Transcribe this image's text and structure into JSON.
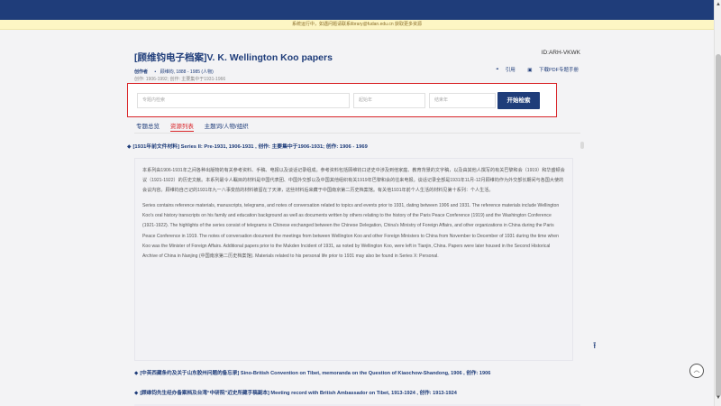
{
  "banner": "系统运行中，如遇问题请联系library@fudan.edu.cn  获取更多资源",
  "header": {
    "title": "[顾维钧电子档案]V. K. Wellington Koo papers",
    "id": "ID:ARH-VKWK",
    "meta_label": "创作者",
    "meta_value": "顾维钧, 1888 - 1985 (人物)",
    "meta_dates": "创作: 1906-1992; 创作: 主要集中于1931-1966",
    "cite": "引用",
    "pdf": "下载PDF专题手册"
  },
  "search": {
    "query_placeholder": "专题内检索",
    "start_placeholder": "起始年",
    "end_placeholder": "结束年",
    "button": "开始检索"
  },
  "tabs": [
    "专题总览",
    "资源列表",
    "主题词/人物/组织"
  ],
  "series": {
    "title": "[1931年前文件材料] Series II: Pre-1931, 1906-1931 , 创作: 主要集中于1906-1931; 创作: 1906 - 1969",
    "desc_zh": "本系列由1906-1931年之间各种出版物的有关参考资料、手稿、电报以及谈话记录组成。参考资料包括顾维钧口述史中涉及到他家庭、教育背景的文字稿，以及由其他人撰写的有关巴黎和会（1919）和华盛顿会议（1921-1922）的历史文献。本系列最令人瞩目的材料是中国代表团、中国外交部以及中国其他组织有关1919年巴黎和会的往来电报。谈话记录全部是1931年11月-12月顾维钧作为外交部长期间与各国大使的会议内容。顾维钧自己记的1931年九一八事变前的材料被留在了天津，这些材料后来藏于中国南京第二历史档案馆。有关他1931年前个人生活的材料见第十系列：个人生活。",
    "desc_en": "Series contains reference materials, manuscripts, telegrams, and notes of conversation related to topics and events prior to 1931, dating between 1906 and 1931. The reference materials include Wellington Koo's oral history transcripts on his family and education background as well as documents written by others relating to the history of the Paris Peace Conference (1919) and the Washington Conference (1921-1922). The highlights of the series consist of telegrams in Chinese exchanged between the Chinese Delegation, China's Ministry of Foreign Affairs, and other organizations in China during the Paris Peace Conference in 1919. The notes of conversation document the meetings from between Wellington Koo and other Foreign Ministers to China from November to December of 1931 during the time when Koo was the Minister of Foreign Affairs. Additional papers prior to the Mukden Incident of 1931, as noted by Wellington Koo, were left in Tianjin, China. Papers were later housed in the Second Historical Archive of China in Nanjing (中国南京第二历史档案馆). Materials related to his personal life prior to 1931 may also be found in Series X: Personal."
  },
  "items": [
    "[中英西藏条约及关于山东胶州问题的备忘录] Sino-British Convention on Tibet, memoranda on the Question of Kiaochow-Shandong, 1906 , 创作: 1906",
    "[顾维钧先生经办备案档及台湾“中研院”近史所藏手稿副本] Meeting record with British Ambassador on Tibet, 1913-1924 , 创作: 1913-1924"
  ]
}
